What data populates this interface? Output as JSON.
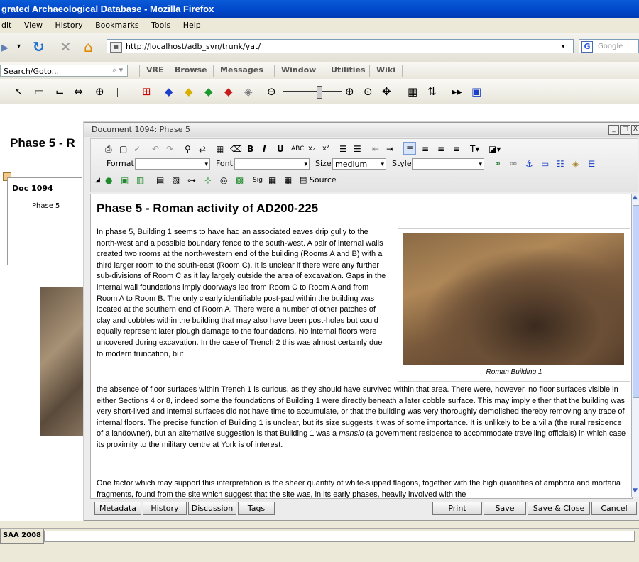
{
  "window": {
    "title": "grated Archaeological Database - Mozilla Firefox"
  },
  "menu": [
    "dit",
    "View",
    "History",
    "Bookmarks",
    "Tools",
    "Help"
  ],
  "nav": {
    "url": "http://localhost/adb_svn/trunk/yat/",
    "google_placeholder": "Google"
  },
  "appmenu": {
    "search_placeholder": "Search/Goto...",
    "items": [
      "VRE",
      "Browse",
      "Messages",
      "Window",
      "Utilities",
      "Wiki"
    ]
  },
  "page": {
    "heading": "Phase 5 - R",
    "doc_tab": {
      "title": "Doc 1094",
      "subtitle": "Phase 5"
    }
  },
  "document": {
    "window_title": "Document 1094: Phase 5",
    "toolbar": {
      "format_label": "Format",
      "font_label": "Font",
      "size_label": "Size",
      "size_value": "medium",
      "style_label": "Style",
      "source_label": "Source"
    },
    "heading": "Phase 5 - Roman activity of AD200-225",
    "figure_caption": "Roman Building 1",
    "paragraph1": "In phase 5, Building 1 seems to have had an associated eaves drip gully to the north-west and a possible boundary fence to the south-west. A pair of internal walls created two rooms at the north-western end of the building (Rooms A and B) with a third larger room to the south-east (Room C). It is unclear if there were any further sub-divisions of Room C as it lay largely outside the area of excavation. Gaps in the internal wall foundations imply doorways led from Room C to Room A and from Room A to Room B. The only clearly identifiable post-pad within the building was located at the southern end of Room A. There were a number of other patches of clay and cobbles within the building that may also have been post-holes but could equally represent later plough damage to the foundations. No internal floors were uncovered during excavation. In the case of Trench 2 this was almost certainly due to modern truncation, but",
    "paragraph1_cont": "the absence of floor surfaces within Trench 1 is curious, as they should have survived within that area. There were, however, no floor surfaces visible in either Sections 4 or 8, indeed some the foundations of Building 1 were directly beneath a later cobble surface. This may imply either that the building was very short-lived and internal surfaces did not have time to accumulate, or that the building was very thoroughly demolished thereby removing any trace of internal floors. The precise function of Building 1 is unclear, but its size suggests it was of some importance. It is unlikely to be a villa (the rural residence of a landowner), but an alternative suggestion is that Building 1 was a",
    "mansio_word": "mansio",
    "paragraph1_end": "(a government residence to accommodate travelling officials) in which case its proximity to the military centre at York is of interest.",
    "paragraph2": "One factor which may support this interpretation is the sheer quantity of white-slipped flagons, together with the high quantities of amphora and mortaria fragments, found from the site which suggest that the site was, in its early phases, heavily involved with the",
    "buttons_left": [
      "Metadata",
      "History",
      "Discussion",
      "Tags"
    ],
    "buttons_right": [
      "Print",
      "Save",
      "Save & Close",
      "Cancel"
    ]
  },
  "status": {
    "tab": "SAA 2008"
  }
}
